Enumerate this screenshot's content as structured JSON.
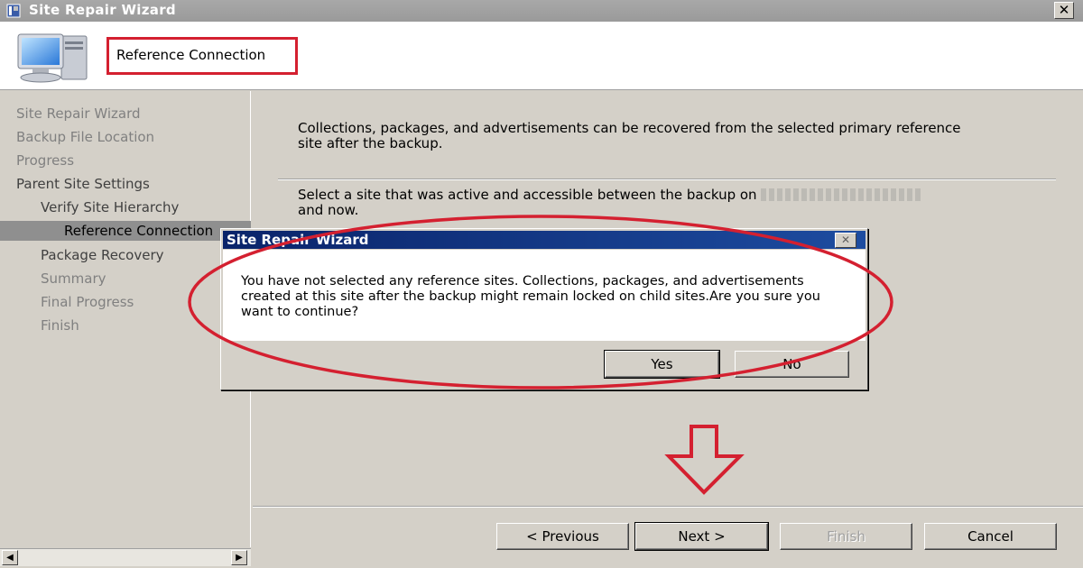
{
  "window": {
    "title": "Site Repair Wizard",
    "close_glyph": "✕"
  },
  "header": {
    "page_title": "Reference Connection"
  },
  "nav": {
    "items": [
      {
        "label": "Site Repair Wizard"
      },
      {
        "label": "Backup File Location"
      },
      {
        "label": "Progress"
      },
      {
        "label": "Parent Site Settings"
      },
      {
        "label": "Verify Site Hierarchy"
      },
      {
        "label": "Reference Connection"
      },
      {
        "label": "Package Recovery"
      },
      {
        "label": "Summary"
      },
      {
        "label": "Final Progress"
      },
      {
        "label": "Finish"
      }
    ],
    "scroll_left": "◀",
    "scroll_right": "▶"
  },
  "main": {
    "description": "Collections, packages, and advertisements can be recovered from the selected primary reference site after the backup.",
    "instruction_start": "Select a site that was active and accessible between the backup on",
    "instruction_end": "and now."
  },
  "footer": {
    "previous": "< Previous",
    "next": "Next >",
    "finish": "Finish",
    "cancel": "Cancel"
  },
  "dialog": {
    "title": "Site Repair Wizard",
    "close_glyph": "✕",
    "message": "You have not selected any reference sites. Collections, packages, and advertisements created at this site after the backup might remain locked on child sites.Are you sure you want to continue?",
    "yes": "Yes",
    "no": "No"
  },
  "colors": {
    "annotation_red": "#d42030",
    "dialog_title_blue": "#0a246a",
    "window_gray": "#d4d0c8"
  },
  "icons": {
    "window": "app-icon",
    "header": "computer-icon",
    "annotation": "down-arrow-icon"
  }
}
